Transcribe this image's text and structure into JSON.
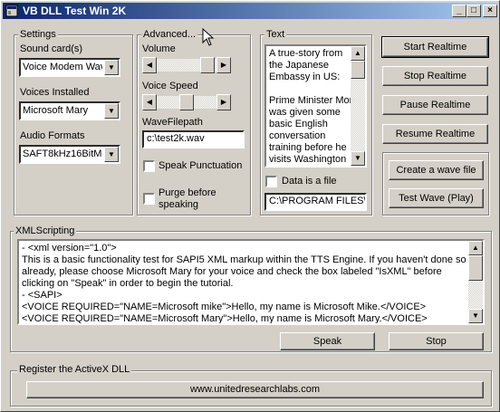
{
  "window": {
    "title": "VB DLL Test Win 2K",
    "min_label": "_",
    "max_label": "□",
    "close_label": "×"
  },
  "settings": {
    "group_label": "Settings",
    "sound_card_label": "Sound card(s)",
    "sound_card_value": "Voice Modem Wav",
    "voices_label": "Voices Installed",
    "voices_value": "Microsoft Mary",
    "audio_label": "Audio Formats",
    "audio_value": "SAFT8kHz16BitMo"
  },
  "advanced": {
    "group_label": "Advanced...",
    "volume_label": "Volume",
    "volume_level": 0.95,
    "speed_label": "Voice Speed",
    "speed_level": 0.5,
    "wavefile_label": "WaveFilepath",
    "wavefile_value": "c:\\test2k.wav",
    "speak_punct_label": "Speak Punctuation",
    "purge_label_line1": "Purge before",
    "purge_label_line2": "speaking"
  },
  "text": {
    "group_label": "Text",
    "lines": [
      "A true-story from",
      "the Japanese",
      "Embassy in US:",
      "",
      "Prime Minister Mori",
      "was given some",
      "basic English",
      "conversation",
      "training before he",
      "visits Washington"
    ],
    "data_file_label": "Data is a file",
    "path_value": "C:\\PROGRAM FILES\\"
  },
  "buttons": {
    "start": "Start Realtime",
    "stop": "Stop Realtime",
    "pause": "Pause Realtime",
    "resume": "Resume Realtime",
    "create_wave": "Create a wave file",
    "test_wave": "Test Wave (Play)"
  },
  "xml": {
    "group_label": "XMLScripting",
    "lines": [
      "- <xml version=\"1.0\">",
      "   This is a basic functionality test for SAPI5 XML markup within the TTS Engine. If you haven't done so",
      "   already, please choose Microsoft Mary for your voice and check the box labeled \"IsXML\" before",
      "   clicking on \"Speak\" in order to begin the tutorial.",
      "- <SAPI>",
      "   <VOICE REQUIRED=\"NAME=Microsoft mike\">Hello, my name is Microsoft Mike.</VOICE>",
      "   <VOICE REQUIRED=\"NAME=Microsoft Mary\">Hello, my name is Microsoft Mary.</VOICE>"
    ],
    "speak": "Speak",
    "stop": "Stop"
  },
  "register": {
    "group_label": "Register the ActiveX DLL",
    "link": "www.unitedresearchlabs.com"
  }
}
